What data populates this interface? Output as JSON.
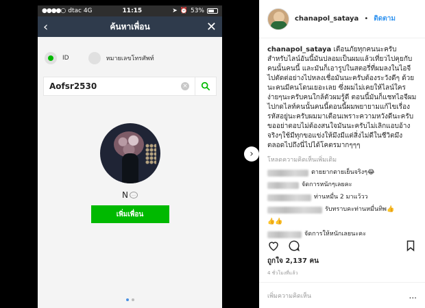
{
  "phone": {
    "status": {
      "carrier": "dtac 4G",
      "time": "11:15",
      "battery": "53%"
    },
    "nav": {
      "title": "ค้นหาเพื่อน"
    },
    "radios": [
      {
        "label": "ID",
        "selected": true
      },
      {
        "label": "หมายเลขโทรศัพท์",
        "selected": false
      }
    ],
    "search": {
      "value": "Aofsr2530"
    },
    "profile": {
      "name": "N"
    },
    "add_button": "เพิ่มเพื่อน"
  },
  "post": {
    "username": "chanapol_sataya",
    "separator": "•",
    "follow": "ติดตาม",
    "caption_user": "chanapol_sataya",
    "caption": "เตือนภัยทุกคนนะครับสำหรับไลน์อันนี้มันปลอมเป็นผมแล้วเที่ยวไปคุยกับคนนั้นคนนี้ และมันก็เอารูปในสตอรี่ที่ผมลงในไอจีไปตัดต่อย่างไปหลงเชื่อมันนะครับต้องระวังดีๆ ด้วยนะคนมีคนโดนเยอะเลย ซึ่งผมไม่เคยให้ไลน์ใครง่ายๆนะครับคนใกล้ตัวผมรู้ดี ตอนนี้มันก็แชทไอจีผมไปกดไลท์คนนั้นคนนี้ตอนนี้ผมพยายามแก้ไขเรื่องรหัสอยู่นะครับผมมาเตือนเพราะความหวังดีนะครับขออย่าตอบไม่ต้องสนใจมันนะครับไม่เลิกแอบอ้างจริงๆใช้มีทุกขอแข่งให้มึงมีแต่สิ่งไม่ดีในชีวิตมึงตลอดไปถึงนี่ไปได้โคตรมากๆๆๆ",
    "more_comments": "โหลดความคิดเห็นเพิ่มเติม",
    "comments": [
      {
        "text": "ตายยากตายเย็นจริงๆ😂"
      },
      {
        "text": "จัดการหนักๆเลยคะ"
      },
      {
        "text": "ท่านหมื่น 2 มาแว้วว"
      },
      {
        "text": "รับทราบคะท่านหมื่นทิพ👍"
      },
      {
        "text": "👍👍"
      },
      {
        "text": "จัดการให้หนักเลยนะคะ"
      }
    ],
    "likes": "ถูกใจ 2,137 คน",
    "time_ago": "4 ชั่วโมงที่แล้ว",
    "add_comment_placeholder": "เพิ่มความคิดเห็น",
    "more_options": "..."
  },
  "colors": {
    "line_green": "#00b900",
    "nav_dark": "#2f3b4c",
    "ig_blue": "#3897f0"
  }
}
